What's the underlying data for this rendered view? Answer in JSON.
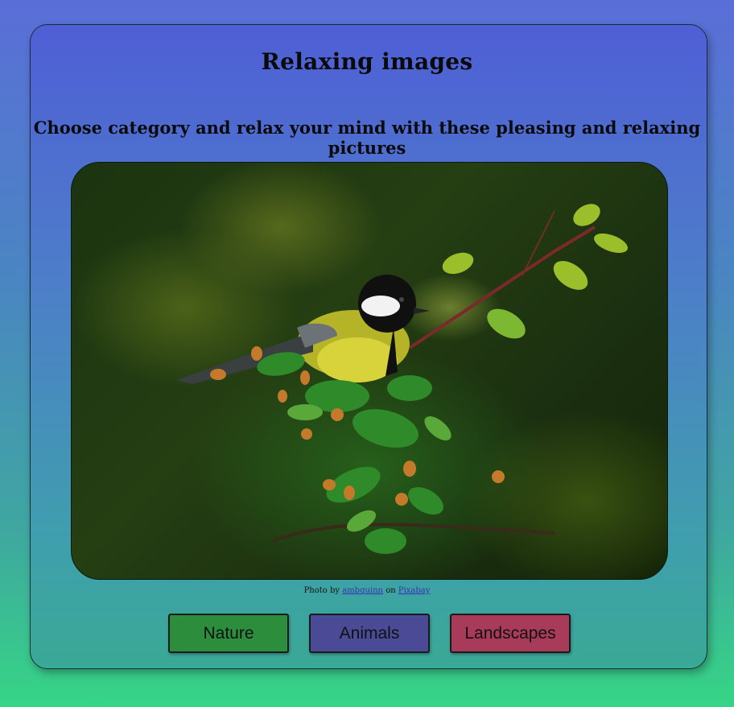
{
  "page": {
    "title": "Relaxing images",
    "subtitle": "Choose category and relax your mind with these pleasing and relaxing pictures"
  },
  "photo": {
    "subject": "Bird perched on flowering branch",
    "credit_prefix": "Photo by",
    "credit_author": "ambquinn",
    "credit_middle": "on",
    "credit_source": "Pixabay"
  },
  "categories": {
    "nature": "Nature",
    "animals": "Animals",
    "landscapes": "Landscapes"
  },
  "colors": {
    "nature": "#2c8e3c",
    "animals": "#4a4a96",
    "landscapes": "#a83b59"
  }
}
